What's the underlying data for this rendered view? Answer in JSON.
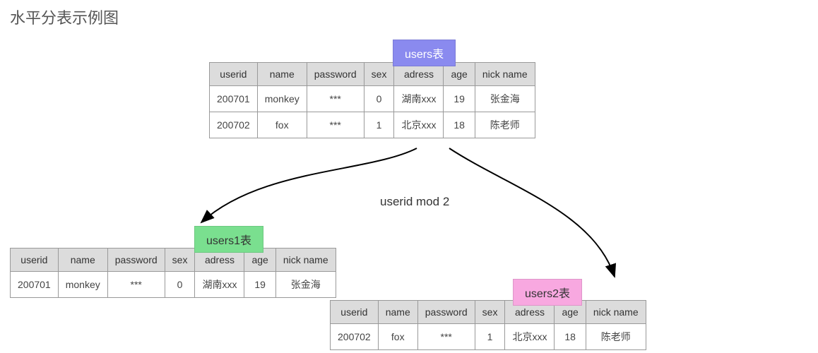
{
  "title": "水平分表示例图",
  "tags": {
    "users": "users表",
    "users1": "users1表",
    "users2": "users2表"
  },
  "annotation": "userid mod 2",
  "columns": [
    "userid",
    "name",
    "password",
    "sex",
    "adress",
    "age",
    "nick name"
  ],
  "users_rows": [
    [
      "200701",
      "monkey",
      "***",
      "0",
      "湖南xxx",
      "19",
      "张金海"
    ],
    [
      "200702",
      "fox",
      "***",
      "1",
      "北京xxx",
      "18",
      "陈老师"
    ]
  ],
  "users1_rows": [
    [
      "200701",
      "monkey",
      "***",
      "0",
      "湖南xxx",
      "19",
      "张金海"
    ]
  ],
  "users2_rows": [
    [
      "200702",
      "fox",
      "***",
      "1",
      "北京xxx",
      "18",
      "陈老师"
    ]
  ]
}
